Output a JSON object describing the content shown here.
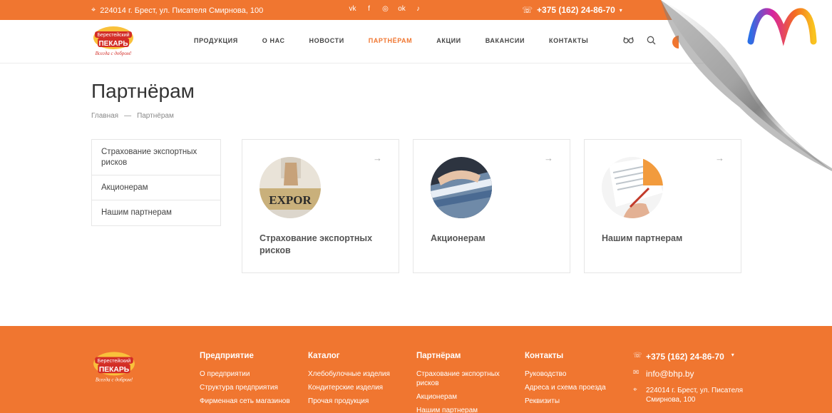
{
  "topbar": {
    "address": "224014 г. Брест, ул. Писателя Смирнова, 100",
    "social": [
      "vk-icon",
      "facebook-icon",
      "instagram-icon",
      "odnoklassniki-icon",
      "tiktok-icon"
    ],
    "phone": "+375 (162) 24-86-70"
  },
  "header": {
    "logo_line1": "Берестейский",
    "logo_line2": "ПЕКАРЬ",
    "logo_slogan": "Всегда с добром!",
    "nav": [
      "ПРОДУКЦИЯ",
      "О НАС",
      "НОВОСТИ",
      "ПАРТНЁРАМ",
      "АКЦИИ",
      "ВАКАНСИИ",
      "КОНТАКТЫ"
    ],
    "active_nav": "ПАРТНЁРАМ"
  },
  "page": {
    "title": "Партнёрам",
    "breadcrumb": [
      "Главная",
      "Партнёрам"
    ],
    "breadcrumb_sep": "—"
  },
  "sidebar": {
    "items": [
      {
        "label": "Страхование экспортных рисков"
      },
      {
        "label": "Акционерам"
      },
      {
        "label": "Нашим партнерам"
      }
    ]
  },
  "cards": [
    {
      "title": "Страхование экспортных рисков",
      "image_text": "EXPOR"
    },
    {
      "title": "Акционерам"
    },
    {
      "title": "Нашим партнерам"
    }
  ],
  "footer": {
    "cols": [
      {
        "heading": "Предприятие",
        "links": [
          "О предприятии",
          "Структура предприятия",
          "Фирменная сеть магазинов"
        ]
      },
      {
        "heading": "Каталог",
        "links": [
          "Хлебобулочные изделия",
          "Кондитерские изделия",
          "Прочая продукция"
        ]
      },
      {
        "heading": "Партнёрам",
        "links": [
          "Страхование экспортных рисков",
          "Акционерам",
          "Нашим партнерам"
        ]
      },
      {
        "heading": "Контакты",
        "links": [
          "Руководство",
          "Адреса и схема проезда",
          "Реквизиты"
        ]
      }
    ],
    "phone": "+375 (162) 24-86-70",
    "email": "info@bhp.by",
    "address": "224014 г. Брест, ул. Писателя Смирнова, 100"
  },
  "colors": {
    "accent": "#f07630"
  }
}
